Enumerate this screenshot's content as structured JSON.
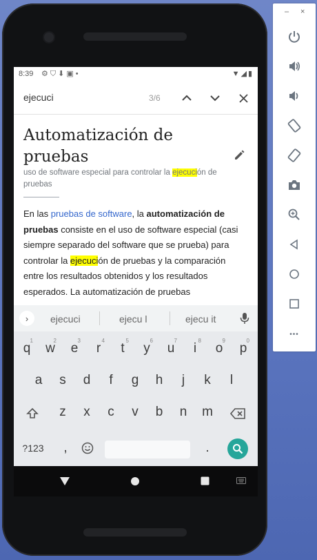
{
  "status_bar": {
    "time": "8:39"
  },
  "find_bar": {
    "query": "ejecuci",
    "count": "3/6"
  },
  "article": {
    "title": "Automatización de pruebas",
    "subtitle_pre": "uso de software especial para controlar la ",
    "subtitle_hl": "ejecuci",
    "subtitle_post": "ón de pruebas",
    "body": {
      "p1": "En las ",
      "link": "pruebas de software",
      "p2": ", la ",
      "bold": "automatización de pruebas",
      "p3": " consiste en el uso de software especial (casi siempre separado del software que se prueba) para controlar la ",
      "hl": "ejecuci",
      "p4": "ón de pruebas y la comparación entre los resultados obtenidos y los resultados esperados. La automatización de pruebas"
    }
  },
  "keyboard": {
    "suggestions": [
      "ejecuci",
      "ejecu l",
      "ejecu it"
    ],
    "row1": [
      "q",
      "w",
      "e",
      "r",
      "t",
      "y",
      "u",
      "i",
      "o",
      "p"
    ],
    "row1_hints": [
      "1",
      "2",
      "3",
      "4",
      "5",
      "6",
      "7",
      "8",
      "9",
      "0"
    ],
    "row2": [
      "a",
      "s",
      "d",
      "f",
      "g",
      "h",
      "j",
      "k",
      "l"
    ],
    "row3": [
      "z",
      "x",
      "c",
      "v",
      "b",
      "n",
      "m"
    ],
    "symbols_label": "?123",
    "comma": ",",
    "period": "."
  },
  "emulator_toolbar": {
    "minimize": "–",
    "close": "×",
    "more": "•••"
  },
  "colors": {
    "highlight": "#ffff00",
    "link": "#3366cc",
    "enter": "#26a69a"
  }
}
